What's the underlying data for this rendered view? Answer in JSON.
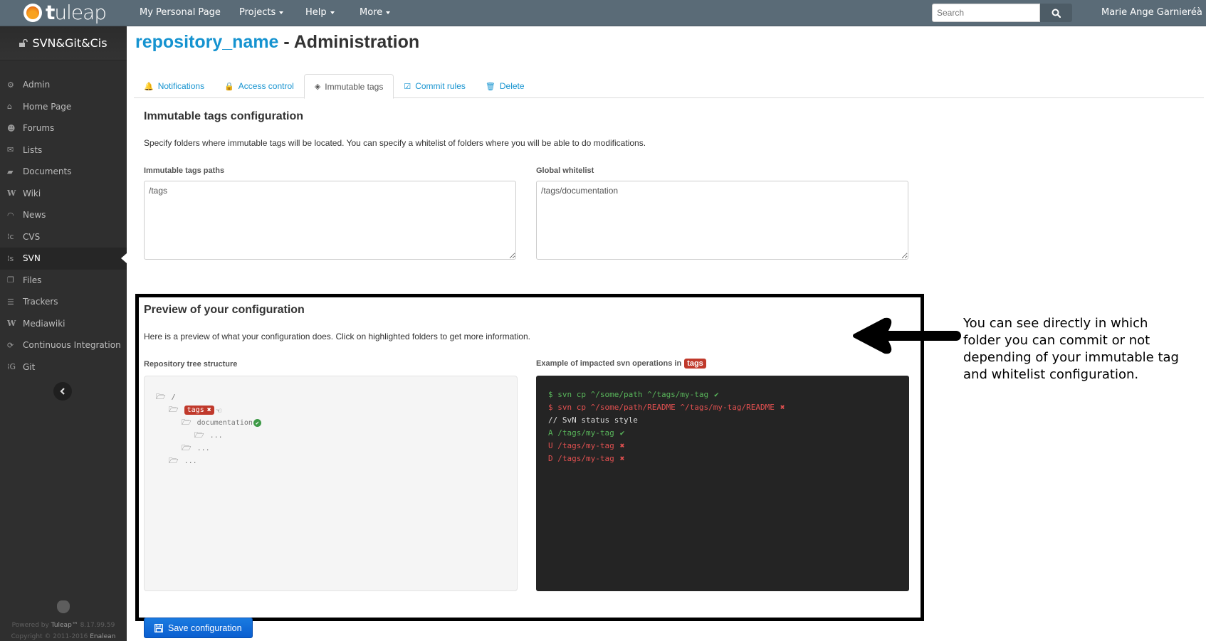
{
  "navbar": {
    "logo_text_bold": "t",
    "logo_text": "uleap",
    "items": [
      {
        "label": "My Personal Page",
        "dropdown": false
      },
      {
        "label": "Projects",
        "dropdown": true
      },
      {
        "label": "Help",
        "dropdown": true
      },
      {
        "label": "More",
        "dropdown": true
      }
    ],
    "search_placeholder": "Search",
    "search_icon": "search-icon",
    "user": "Marie Ange Garnieréà"
  },
  "sidebar": {
    "project_name": "SVN&Git&Cis",
    "project_icon": "unlock-icon",
    "items": [
      {
        "label": "Admin",
        "icon": "cogs-icon",
        "glyph": "⚙",
        "active": false
      },
      {
        "label": "Home Page",
        "icon": "home-icon",
        "glyph": "⌂",
        "active": false
      },
      {
        "label": "Forums",
        "icon": "users-icon",
        "glyph": "☻",
        "active": false
      },
      {
        "label": "Lists",
        "icon": "envelope-icon",
        "glyph": "✉",
        "active": false
      },
      {
        "label": "Documents",
        "icon": "folder-open-icon",
        "glyph": "▰",
        "active": false
      },
      {
        "label": "Wiki",
        "icon": "wiki-icon",
        "glyph": "W",
        "active": false
      },
      {
        "label": "News",
        "icon": "rss-icon",
        "glyph": "◠",
        "active": false
      },
      {
        "label": "CVS",
        "icon": "cvs-icon",
        "glyph": "⁞c",
        "active": false
      },
      {
        "label": "SVN",
        "icon": "svn-icon",
        "glyph": "⁞s",
        "active": true
      },
      {
        "label": "Files",
        "icon": "files-icon",
        "glyph": "❐",
        "active": false
      },
      {
        "label": "Trackers",
        "icon": "list-icon",
        "glyph": "☰",
        "active": false
      },
      {
        "label": "Mediawiki",
        "icon": "mediawiki-icon",
        "glyph": "W",
        "active": false
      },
      {
        "label": "Continuous Integration",
        "icon": "refresh-icon",
        "glyph": "⟳",
        "active": false
      },
      {
        "label": "Git",
        "icon": "git-icon",
        "glyph": "⁞G",
        "active": false
      }
    ],
    "footer": {
      "powered_prefix": "Powered by ",
      "powered_brand": "Tuleap™",
      "version": " 8.17.99.59",
      "copyright_prefix": "Copyright © 2011-2016 ",
      "copyright_brand": "Enalean"
    }
  },
  "page": {
    "title_repo": "repository_name",
    "title_suffix": " - Administration",
    "tabs": [
      {
        "label": "Notifications",
        "icon": "bell-icon",
        "glyph": "🔔",
        "active": false
      },
      {
        "label": "Access control",
        "icon": "lock-icon",
        "glyph": "🔒",
        "active": false
      },
      {
        "label": "Immutable tags",
        "icon": "tags-icon",
        "glyph": "◈",
        "active": true
      },
      {
        "label": "Commit rules",
        "icon": "check-square-icon",
        "glyph": "☑",
        "active": false
      },
      {
        "label": "Delete",
        "icon": "trash-icon",
        "glyph": "🗑",
        "active": false
      }
    ],
    "config": {
      "heading": "Immutable tags configuration",
      "description": "Specify folders where immutable tags will be located. You can specify a whitelist of folders where you will be able to do modifications.",
      "paths_label": "Immutable tags paths",
      "paths_value": "/tags",
      "whitelist_label": "Global whitelist",
      "whitelist_value": "/tags/documentation"
    },
    "preview": {
      "heading": "Preview of your configuration",
      "description": "Here is a preview of what your configuration does. Click on highlighted folders to get more information.",
      "tree_label": "Repository tree structure",
      "ops_label": "Example of impacted svn operations in",
      "ops_badge": "tags",
      "tree": [
        {
          "label": "/",
          "level": 0,
          "badge": false,
          "status": ""
        },
        {
          "label": "tags",
          "level": 1,
          "badge": true,
          "status": "immutable"
        },
        {
          "label": "documentation",
          "level": 2,
          "badge": false,
          "status": "whitelisted"
        },
        {
          "label": "...",
          "level": 3,
          "badge": false,
          "status": ""
        },
        {
          "label": "...",
          "level": 2,
          "badge": false,
          "status": ""
        },
        {
          "label": "...",
          "level": 1,
          "badge": false,
          "status": ""
        }
      ],
      "operations": [
        {
          "text": "$ svn cp ^/some/path ^/tags/my-tag",
          "state": "ok"
        },
        {
          "text": "$ svn cp ^/some/path/README ^/tags/my-tag/README",
          "state": "ko"
        },
        {
          "text": "// SvN status style",
          "state": "comment"
        },
        {
          "text": "A /tags/my-tag",
          "state": "ok"
        },
        {
          "text": "U /tags/my-tag",
          "state": "ko"
        },
        {
          "text": "D /tags/my-tag",
          "state": "ko"
        }
      ]
    },
    "save_label": "Save configuration"
  },
  "annotation": {
    "lines": [
      "You can see directly in which",
      "folder you can commit or not",
      "depending of your immutable tag",
      "and whitelist configuration."
    ]
  }
}
